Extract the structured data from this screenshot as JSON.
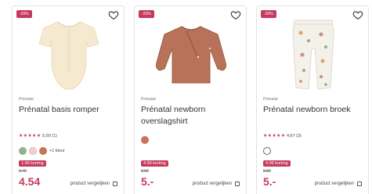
{
  "products": [
    {
      "discount_badge": "-20%",
      "brand": "Prénatal",
      "name": "Prénatal basis romper",
      "stars": "★★★★★",
      "rating": "5,00 (1)",
      "swatch_colors": [
        "#93b38a",
        "#f1d1cf",
        "#c9735a"
      ],
      "more_colors": "+1 kleur",
      "promo": "1.95 korting",
      "old_price": "6.49",
      "price": "4.54",
      "compare_label": "product vergelijken"
    },
    {
      "discount_badge": "-20%",
      "brand": "Prénatal",
      "name": "Prénatal newborn overslagshirt",
      "swatch_colors": [
        "#c9735a"
      ],
      "promo": "4.99 korting",
      "old_price": "9.99",
      "price": "5.-",
      "compare_label": "product vergelijken"
    },
    {
      "discount_badge": "-20%",
      "brand": "Prénatal",
      "name": "Prénatal newborn broek",
      "stars": "★★★★★",
      "rating": "4,67 (3)",
      "swatch_colors": [
        "#ffffff"
      ],
      "promo": "4.99 korting",
      "old_price": "9.99",
      "price": "5.-",
      "compare_label": "product vergelijken"
    }
  ]
}
